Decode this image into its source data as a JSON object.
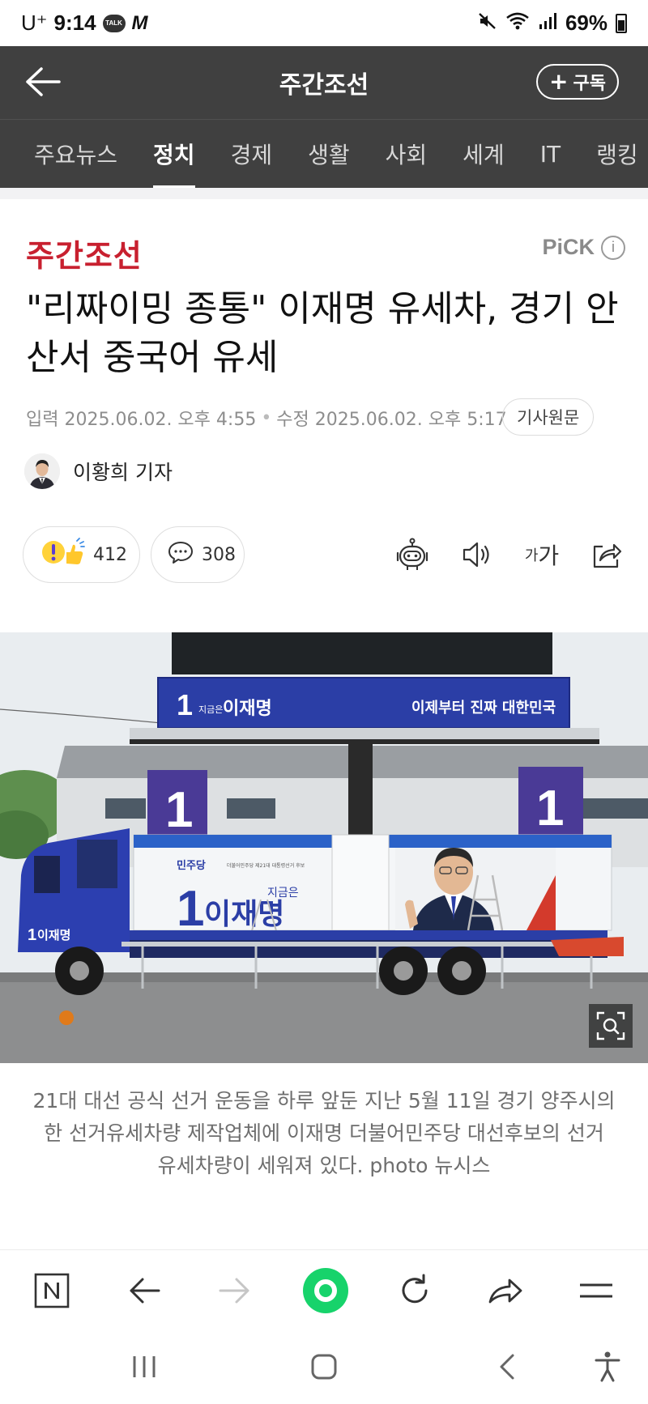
{
  "status_bar": {
    "carrier": "U⁺",
    "time": "9:14",
    "talk_badge": "TALK",
    "m_icon": "M",
    "battery": "69%",
    "icons": [
      "mute-icon",
      "wifi-icon",
      "signal-icon",
      "battery-icon"
    ]
  },
  "header": {
    "title": "주간조선",
    "subscribe_label": "구독",
    "subscribe_plus": "+"
  },
  "tabs": [
    "주요뉴스",
    "정치",
    "경제",
    "생활",
    "사회",
    "세계",
    "IT",
    "랭킹"
  ],
  "active_tab": "정치",
  "article": {
    "publisher_logo": "주간조선",
    "pick_label": "PiCK",
    "pick_info": "i",
    "headline": "\"리짜이밍 종통\" 이재명 유세차, 경기 안산서 중국어 유세",
    "input_label": "입력",
    "input_date": "2025.06.02. 오후 4:55",
    "edit_label": "수정",
    "edit_date": "2025.06.02. 오후 5:17",
    "meta_sep": "•",
    "original_button": "기사원문",
    "author": "이황희 기자",
    "reaction_count": "412",
    "comment_count": "308",
    "font_button_small": "가",
    "font_button_large": "가",
    "caption": "21대 대선 공식 선거 운동을 하루 앞둔 지난 5월 11일 경기 양주시의 한 선거유세차량 제작업체에 이재명 더불어민주당 대선후보의 선거 유세차량이 세워져 있다. photo 뉴시스"
  },
  "photo": {
    "banner_number": "1",
    "banner_small": "지금은",
    "banner_name": "이재명",
    "banner_slogan": "이제부터 진짜 대한민국",
    "side_number": "1",
    "side_small": "지금은",
    "side_name": "이재명",
    "party": "민주당",
    "party_line": "더불어민주당 제21대 대통령선거 후보",
    "cab_number": "1",
    "cab_name": "이재명"
  },
  "colors": {
    "header_bg": "#404040",
    "brand_red": "#c8202f",
    "campaign_blue": "#2a3ea8",
    "green_home": "#17d36b"
  }
}
